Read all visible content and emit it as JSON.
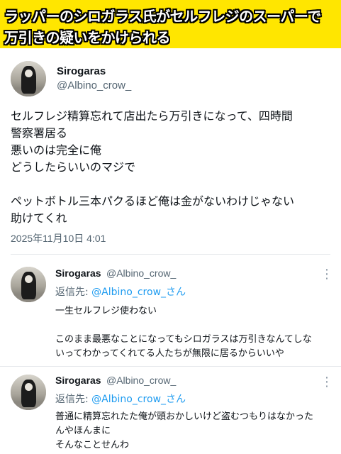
{
  "banner": {
    "line1": "ラッパーのシロガラス氏がセルフレジのスーパーで",
    "line2": "万引きの疑いをかけられる"
  },
  "main_post": {
    "display_name": "Sirogaras",
    "handle": "@Albino_crow_",
    "lines": [
      "セルフレジ精算忘れて店出たら万引きになって、四時間",
      "警察署居る",
      "悪いのは完全に俺",
      "どうしたらいいのマジで",
      "",
      "ペットボトル三本パクるほど俺は金がないわけじゃない",
      "助けてくれ"
    ],
    "timestamp": "2025年11月10日 4:01"
  },
  "replies": [
    {
      "display_name": "Sirogaras",
      "handle": "@Albino_crow_",
      "more_icon": "more-vertical-icon",
      "reply_label": "返信先:",
      "reply_mention": "@Albino_crow_さん",
      "lines": [
        "一生セルフレジ使わない",
        "",
        "このまま最悪なことになってもシロガラスは万引きなんてしな",
        "いってわかってくれてる人たちが無限に居るからいいや"
      ]
    },
    {
      "display_name": "Sirogaras",
      "handle": "@Albino_crow_",
      "more_icon": "more-vertical-icon",
      "reply_label": "返信先:",
      "reply_mention": "@Albino_crow_さん",
      "lines": [
        "普通に精算忘れたた俺が頭おかしいけど盗むつもりはなかった",
        "んやほんまに",
        "そんなことせんわ"
      ]
    }
  ],
  "colors": {
    "banner_bg": "#ffe600",
    "text": "#0f1419",
    "secondary": "#536471",
    "link": "#1d9bf0",
    "divider": "#e6e9ec"
  }
}
